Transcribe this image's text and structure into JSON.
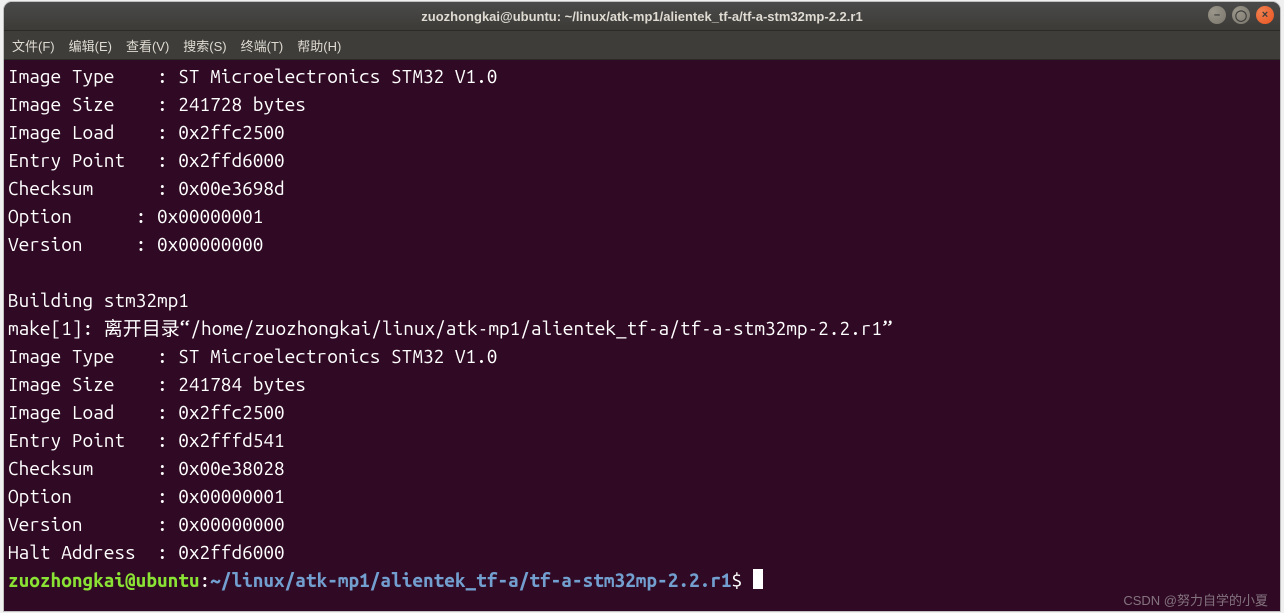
{
  "window": {
    "title": "zuozhongkai@ubuntu: ~/linux/atk-mp1/alientek_tf-a/tf-a-stm32mp-2.2.r1"
  },
  "menu": {
    "file": "文件(F)",
    "edit": "编辑(E)",
    "view": "查看(V)",
    "search": "搜索(S)",
    "terminal": "终端(T)",
    "help": "帮助(H)"
  },
  "output": {
    "block1": {
      "image_type": "Image Type    : ST Microelectronics STM32 V1.0",
      "image_size": "Image Size    : 241728 bytes",
      "image_load": "Image Load    : 0x2ffc2500",
      "entry_point": "Entry Point   : 0x2ffd6000",
      "checksum": "Checksum      : 0x00e3698d",
      "option": "Option      : 0x00000001",
      "version": "Version     : 0x00000000"
    },
    "building": "Building stm32mp1",
    "make_leave": "make[1]: 离开目录“/home/zuozhongkai/linux/atk-mp1/alientek_tf-a/tf-a-stm32mp-2.2.r1”",
    "block2": {
      "image_type": "Image Type    : ST Microelectronics STM32 V1.0",
      "image_size": "Image Size    : 241784 bytes",
      "image_load": "Image Load    : 0x2ffc2500",
      "entry_point": "Entry Point   : 0x2fffd541",
      "checksum": "Checksum      : 0x00e38028",
      "option": "Option        : 0x00000001",
      "version": "Version       : 0x00000000",
      "halt_addr": "Halt Address  : 0x2ffd6000"
    }
  },
  "prompt": {
    "user_host": "zuozhongkai@ubuntu",
    "colon": ":",
    "path": "~/linux/atk-mp1/alientek_tf-a/tf-a-stm32mp-2.2.r1",
    "symbol": "$"
  },
  "watermark": "CSDN @努力自学的小夏"
}
